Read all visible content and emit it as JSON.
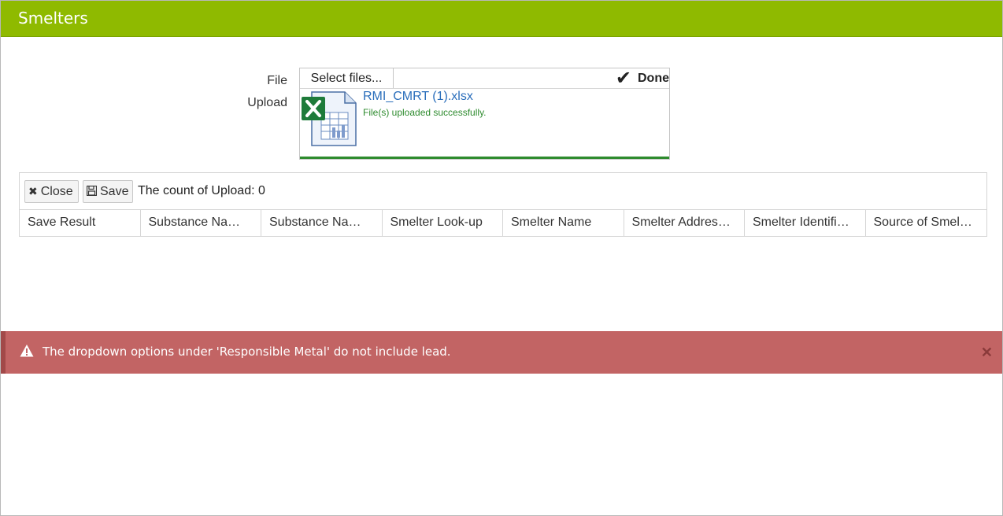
{
  "window": {
    "title": "Smelters"
  },
  "upload": {
    "label": "File Upload",
    "select_button": "Select files...",
    "status": "Done",
    "file_name": "RMI_CMRT (1).xlsx",
    "file_message": "File(s) uploaded successfully.",
    "progress_percent": 100,
    "file_icon": "excel-file-icon"
  },
  "toolbar": {
    "close_label": "Close",
    "save_label": "Save",
    "count_text": "The count of Upload:  0"
  },
  "grid": {
    "columns": [
      "Save Result",
      "Substance Na…",
      "Substance Na…",
      "Smelter Look-up",
      "Smelter Name",
      "Smelter Addres…",
      "Smelter Identifi…",
      "Source of Smel…"
    ],
    "rows": []
  },
  "alert": {
    "icon": "warning-icon",
    "message": "The dropdown options under 'Responsible Metal' do not include lead.",
    "close_icon": "close-icon"
  },
  "colors": {
    "titlebar": "#8fba00",
    "alert_bg": "#c26464",
    "success": "#2e8b2e",
    "link": "#2a6ebb"
  }
}
